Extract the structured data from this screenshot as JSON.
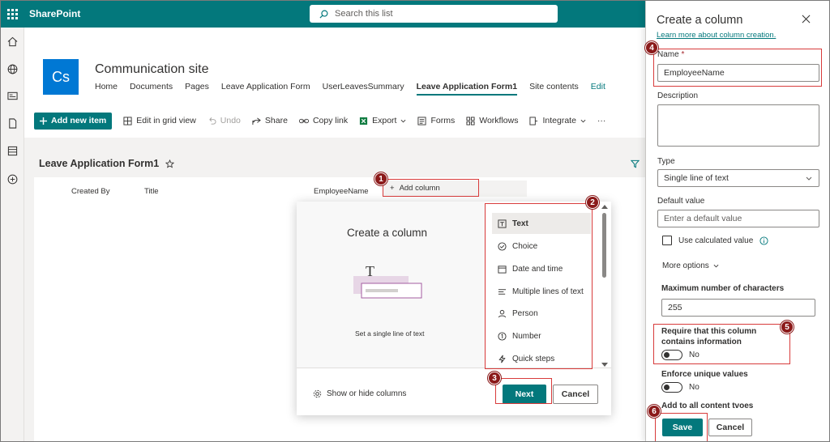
{
  "suitebar": {
    "brand": "SharePoint",
    "search_placeholder": "Search this list"
  },
  "site": {
    "logo_text": "Cs",
    "title": "Communication site",
    "nav": [
      "Home",
      "Documents",
      "Pages",
      "Leave Application Form",
      "UserLeavesSummary",
      "Leave Application Form1",
      "Site contents"
    ],
    "active_nav": "Leave Application Form1",
    "edit_label": "Edit"
  },
  "commandbar": {
    "new_item": "Add new item",
    "edit_grid": "Edit in grid view",
    "undo": "Undo",
    "share": "Share",
    "copy_link": "Copy link",
    "export": "Export",
    "forms": "Forms",
    "workflows": "Workflows",
    "integrate": "Integrate",
    "more": "···"
  },
  "list": {
    "title": "Leave Application Form1",
    "columns": {
      "created_by": "Created By",
      "title": "Title",
      "employee_name": "EmployeeName",
      "add_column": "Add column"
    }
  },
  "dialog": {
    "title": "Create a column",
    "description": "Set a single line of text",
    "types": [
      "Text",
      "Choice",
      "Date and time",
      "Multiple lines of text",
      "Person",
      "Number",
      "Quick steps"
    ],
    "selected_type": "Text",
    "show_hide": "Show or hide columns",
    "next": "Next",
    "cancel": "Cancel"
  },
  "panel": {
    "title": "Create a column",
    "learn_more": "Learn more about column creation.",
    "name_label": "Name",
    "required_mark": "*",
    "name_value": "EmployeeName",
    "description_label": "Description",
    "type_label": "Type",
    "type_value": "Single line of text",
    "default_label": "Default value",
    "default_placeholder": "Enter a default value",
    "calculated_label": "Use calculated value",
    "more_options": "More options",
    "max_chars_label": "Maximum number of characters",
    "max_chars_value": "255",
    "require_label": "Require that this column contains information",
    "require_toggle": "No",
    "unique_label": "Enforce unique values",
    "unique_toggle": "No",
    "add_to_all": "Add to all content tvoes",
    "save": "Save",
    "cancel": "Cancel"
  },
  "callouts": [
    "1",
    "2",
    "3",
    "4",
    "5",
    "6"
  ],
  "colors": {
    "accent": "#03787c",
    "callout": "#8b1a1a",
    "highlight_box": "#d83b3b"
  }
}
